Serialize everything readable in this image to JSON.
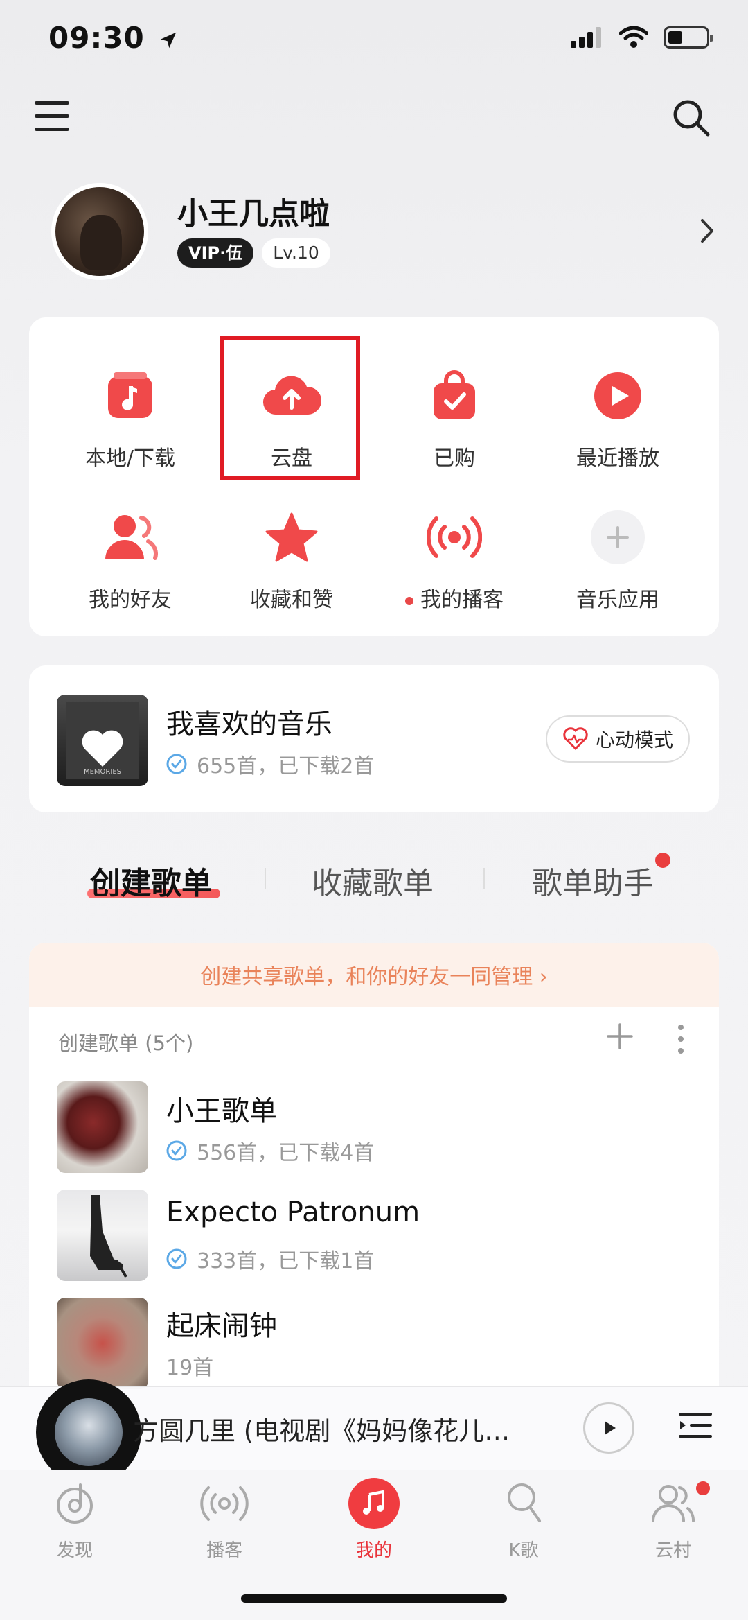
{
  "status": {
    "time": "09:30"
  },
  "profile": {
    "name": "小王几点啦",
    "vip": "VIP·伍",
    "level": "Lv.10"
  },
  "grid": [
    {
      "label": "本地/下载"
    },
    {
      "label": "云盘"
    },
    {
      "label": "已购"
    },
    {
      "label": "最近播放"
    },
    {
      "label": "我的好友"
    },
    {
      "label": "收藏和赞"
    },
    {
      "label": "我的播客"
    },
    {
      "label": "音乐应用"
    }
  ],
  "favorite": {
    "title": "我喜欢的音乐",
    "sub": "655首，已下载2首",
    "mode_button": "心动模式",
    "cover_text": "MEMORIES"
  },
  "tabs": [
    "创建歌单",
    "收藏歌单",
    "歌单助手"
  ],
  "share_banner": "创建共享歌单，和你的好友一同管理 ›",
  "list_header": "创建歌单 (5个)",
  "playlists": [
    {
      "title": "小王歌单",
      "sub": "556首，已下载4首"
    },
    {
      "title": "Expecto Patronum",
      "sub": "333首，已下载1首"
    },
    {
      "title": "起床闹钟",
      "sub": "19首"
    }
  ],
  "mini_player": {
    "title": "方圆几里 (电视剧《妈妈像花儿一样开放》插曲)"
  },
  "nav": [
    {
      "label": "发现"
    },
    {
      "label": "播客"
    },
    {
      "label": "我的"
    },
    {
      "label": "K歌"
    },
    {
      "label": "云村"
    }
  ],
  "colors": {
    "accent": "#f03c40",
    "highlight": "#e01b24",
    "banner_text": "#e9835a"
  }
}
